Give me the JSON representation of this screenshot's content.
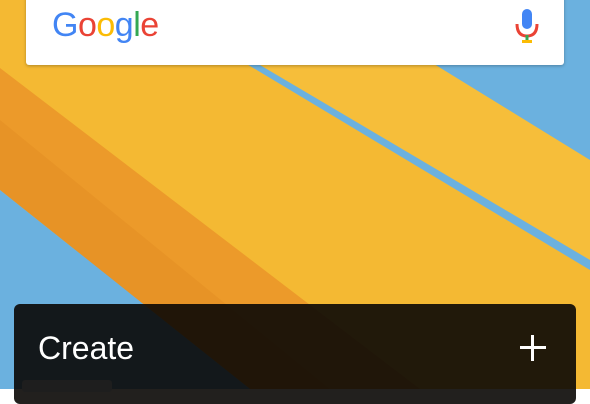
{
  "search_widget": {
    "logo_letters": [
      "G",
      "o",
      "o",
      "g",
      "l",
      "e"
    ],
    "logo_colors": [
      "#4285F4",
      "#EA4335",
      "#FBBC05",
      "#4285F4",
      "#34A853",
      "#EA4335"
    ],
    "mic_icon": "microphone-icon"
  },
  "create_panel": {
    "label": "Create",
    "action_icon": "plus-icon"
  },
  "colors": {
    "sky": "#6BB1DF",
    "stripe_light": "#F4B933",
    "stripe_dark": "#EC9A2A",
    "panel": "#0A0806"
  }
}
